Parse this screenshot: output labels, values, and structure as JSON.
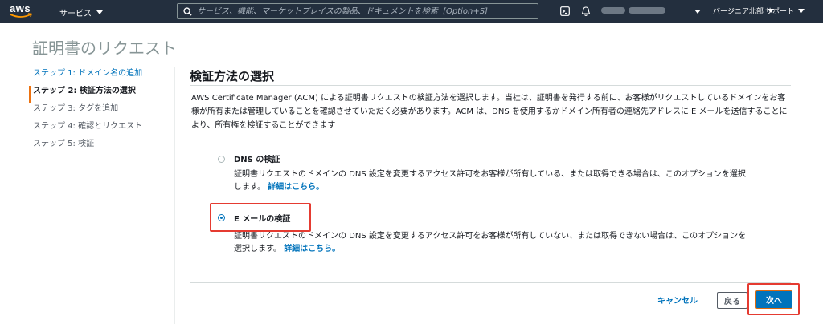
{
  "nav": {
    "logo": "aws",
    "services_label": "サービス",
    "search_placeholder": "サービス、機能、マーケットプレイスの製品、ドキュメントを検索  [Option+S]",
    "region_label": "バージニア北部",
    "support_label": "サポート"
  },
  "page": {
    "title": "証明書のリクエスト"
  },
  "steps": [
    {
      "label": "ステップ 1: ドメイン名の追加",
      "state": "link"
    },
    {
      "label": "ステップ 2: 検証方法の選択",
      "state": "active"
    },
    {
      "label": "ステップ 3: タグを追加",
      "state": "default"
    },
    {
      "label": "ステップ 4: 確認とリクエスト",
      "state": "default"
    },
    {
      "label": "ステップ 5: 検証",
      "state": "default"
    }
  ],
  "main": {
    "section_title": "検証方法の選択",
    "description": "AWS Certificate Manager (ACM) による証明書リクエストの検証方法を選択します。当社は、証明書を発行する前に、お客様がリクエストしているドメインをお客様が所有または管理していることを確認させていただく必要があります。ACM は、DNS を使用するかドメイン所有者の連絡先アドレスに E メールを送信することにより、所有権を検証することができます",
    "options": [
      {
        "label": "DNS の検証",
        "description": "証明書リクエストのドメインの DNS 設定を変更するアクセス許可をお客様が所有している、または取得できる場合は、このオプションを選択します。",
        "link": "詳細はこちら。",
        "selected": false
      },
      {
        "label": "E メールの検証",
        "description": "証明書リクエストのドメインの DNS 設定を変更するアクセス許可をお客様が所有していない、または取得できない場合は、このオプションを選択します。",
        "link": "詳細はこちら。",
        "selected": true
      }
    ]
  },
  "footer": {
    "cancel_label": "キャンセル",
    "back_label": "戻る",
    "next_label": "次へ"
  },
  "colors": {
    "nav_bg": "#232f3e",
    "link": "#0073bb",
    "active_step_bar": "#ec7211",
    "primary_button": "#0073bb",
    "highlight": "#e53b31"
  }
}
